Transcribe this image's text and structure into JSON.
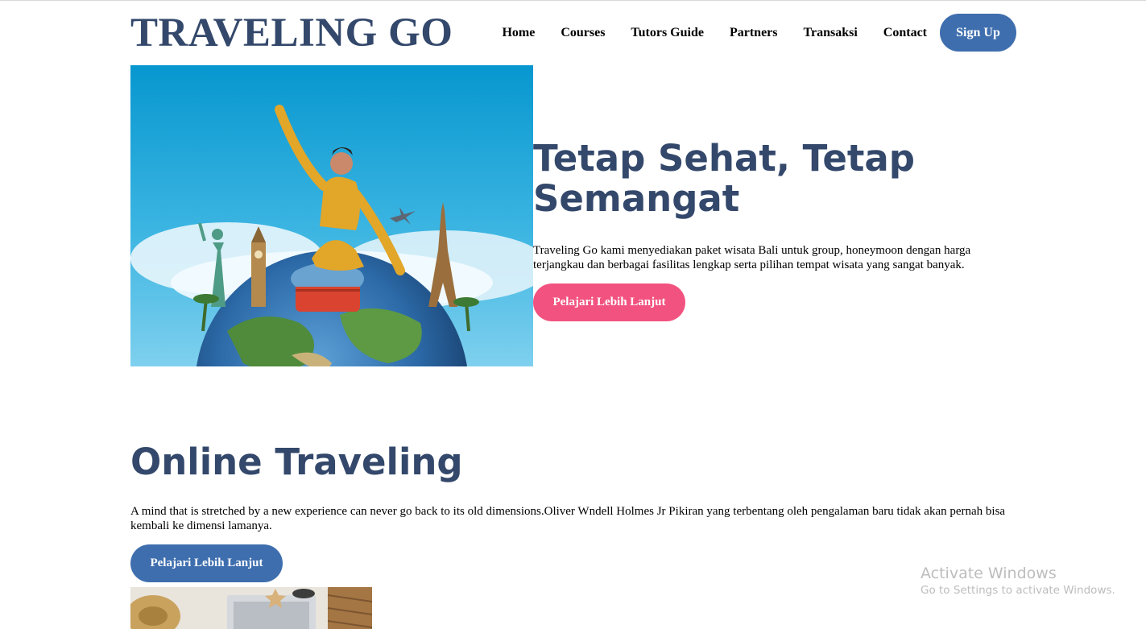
{
  "header": {
    "logo": "TRAVELING GO",
    "nav": [
      "Home",
      "Courses",
      "Tutors Guide",
      "Partners",
      "Transaksi",
      "Contact"
    ],
    "signup_label": "Sign Up"
  },
  "hero": {
    "title": "Tetap Sehat, Tetap Semangat",
    "text": "Traveling Go kami menyediakan paket wisata Bali untuk group, honeymoon dengan harga terjangkau dan berbagai fasilitas lengkap serta pilihan tempat wisata yang sangat banyak.",
    "button_label": "Pelajari Lebih Lanjut"
  },
  "section": {
    "title": "Online Traveling",
    "text": "A mind that is stretched by a new experience can never go back to its old dimensions.Oliver Wndell Holmes Jr Pikiran yang terbentang oleh pengalaman baru tidak akan pernah bisa kembali ke dimensi lamanya.",
    "button_label": "Pelajari Lebih Lanjut"
  },
  "watermark": {
    "title": "Activate Windows",
    "subtitle": "Go to Settings to activate Windows."
  },
  "colors": {
    "brand": "#33486b",
    "primary_button": "#3e6eae",
    "accent_button": "#f2527f"
  }
}
